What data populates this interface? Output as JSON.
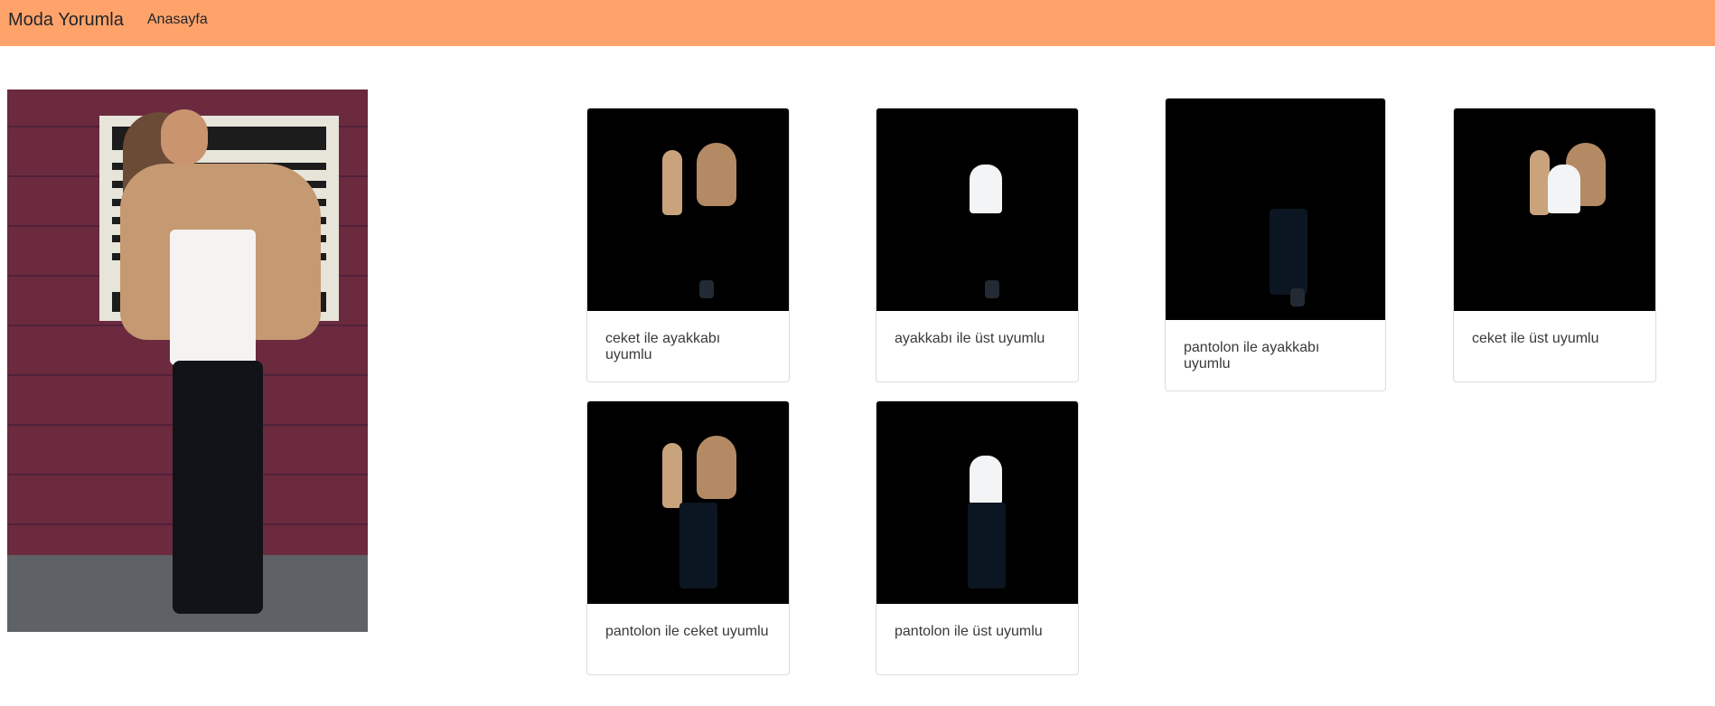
{
  "navbar": {
    "brand": "Moda Yorumla",
    "links": [
      "Anasayfa"
    ]
  },
  "main_photo": {
    "sign_text": "TOW AWAY NOTICE"
  },
  "cards": [
    {
      "caption": "ceket ile ayakkabı uyumlu",
      "items": [
        "jacket",
        "shoe"
      ]
    },
    {
      "caption": "ayakkabı ile üst uyumlu",
      "items": [
        "shirt",
        "shoe"
      ]
    },
    {
      "caption": "pantolon ile ayakkabı uyumlu",
      "items": [
        "pants",
        "shoe"
      ]
    },
    {
      "caption": "ceket ile üst uyumlu",
      "items": [
        "jacket",
        "shirt"
      ]
    },
    {
      "caption": "pantolon ile ceket uyumlu",
      "items": [
        "jacket",
        "pants"
      ]
    },
    {
      "caption": "pantolon ile üst uyumlu",
      "items": [
        "shirt",
        "pants"
      ]
    }
  ],
  "colors": {
    "navbar": "#ffa36b",
    "card_border": "#dcdcdc",
    "thumb_bg": "#000000"
  }
}
